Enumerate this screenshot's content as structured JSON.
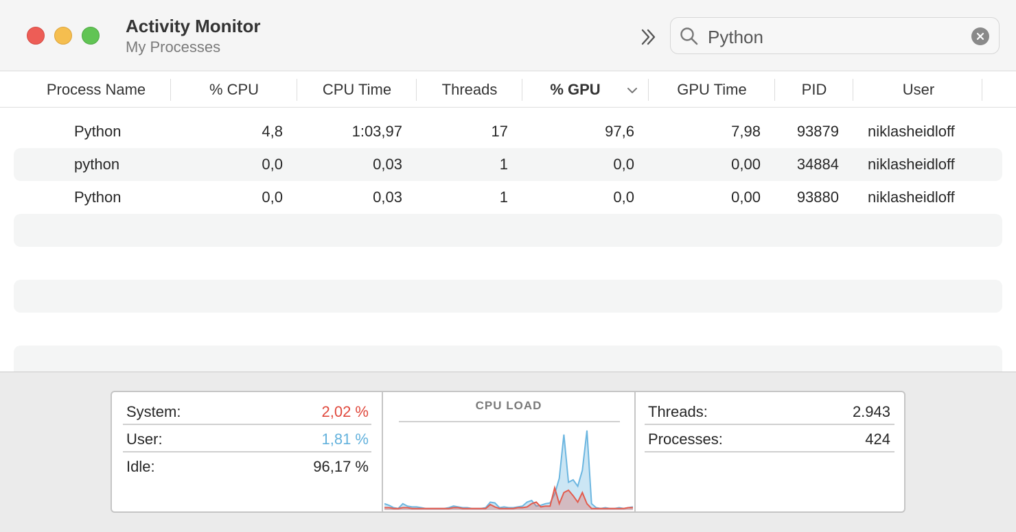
{
  "window": {
    "title": "Activity Monitor",
    "subtitle": "My Processes"
  },
  "search": {
    "query": "Python"
  },
  "columns": [
    {
      "label": "Process Name"
    },
    {
      "label": "% CPU"
    },
    {
      "label": "CPU Time"
    },
    {
      "label": "Threads"
    },
    {
      "label": "% GPU",
      "sorted": "descending"
    },
    {
      "label": "GPU Time"
    },
    {
      "label": "PID"
    },
    {
      "label": "User"
    }
  ],
  "processes": [
    {
      "name": "Python",
      "cpu": "4,8",
      "cpu_time": "1:03,97",
      "threads": "17",
      "gpu": "97,6",
      "gpu_time": "7,98",
      "pid": "93879",
      "user": "niklasheidloff"
    },
    {
      "name": "python",
      "cpu": "0,0",
      "cpu_time": "0,03",
      "threads": "1",
      "gpu": "0,0",
      "gpu_time": "0,00",
      "pid": "34884",
      "user": "niklasheidloff"
    },
    {
      "name": "Python",
      "cpu": "0,0",
      "cpu_time": "0,03",
      "threads": "1",
      "gpu": "0,0",
      "gpu_time": "0,00",
      "pid": "93880",
      "user": "niklasheidloff"
    }
  ],
  "stats": {
    "system_label": "System:",
    "system_value": "2,02 %",
    "user_label": "User:",
    "user_value": "1,81 %",
    "idle_label": "Idle:",
    "idle_value": "96,17 %",
    "threads_label": "Threads:",
    "threads_value": "2.943",
    "processes_label": "Processes:",
    "processes_value": "424"
  },
  "cpu_load": {
    "title": "CPU LOAD",
    "user_series": [
      8,
      6,
      3,
      2,
      8,
      5,
      4,
      4,
      3,
      2,
      2,
      2,
      2,
      2,
      3,
      5,
      4,
      3,
      3,
      2,
      2,
      2,
      3,
      10,
      9,
      3,
      4,
      3,
      3,
      4,
      5,
      10,
      12,
      5,
      6,
      8,
      9,
      20,
      40,
      95,
      35,
      38,
      30,
      50,
      100,
      8,
      3,
      2,
      3,
      2,
      2,
      3,
      2,
      3,
      4
    ],
    "system_series": [
      3,
      3,
      2,
      2,
      3,
      3,
      2,
      2,
      2,
      2,
      2,
      2,
      2,
      2,
      2,
      3,
      3,
      2,
      2,
      2,
      2,
      2,
      2,
      7,
      4,
      2,
      2,
      2,
      2,
      3,
      3,
      4,
      8,
      10,
      4,
      5,
      5,
      28,
      8,
      22,
      25,
      18,
      10,
      22,
      8,
      2,
      2,
      2,
      2,
      2,
      2,
      2,
      2,
      3,
      3
    ],
    "user_color": "#6cb6e0",
    "system_color": "#e35b4d"
  }
}
